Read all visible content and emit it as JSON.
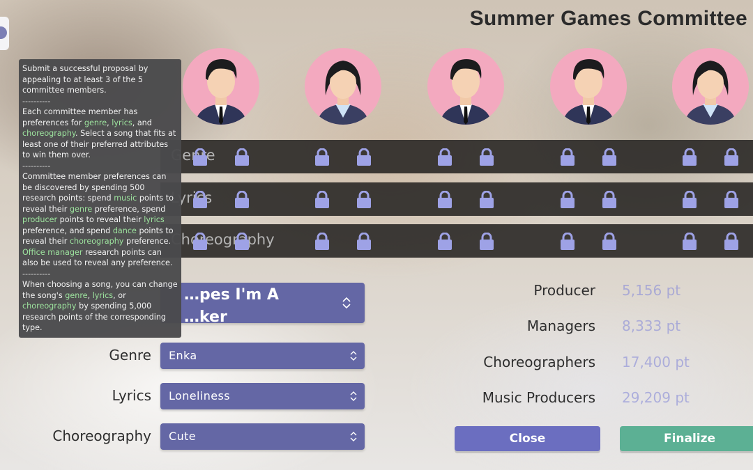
{
  "title": "Summer Games Committee",
  "members": [
    {
      "gender": "male"
    },
    {
      "gender": "female"
    },
    {
      "gender": "male"
    },
    {
      "gender": "male"
    },
    {
      "gender": "female"
    }
  ],
  "preference_rows": [
    {
      "label": "Genre",
      "locked": true
    },
    {
      "label": "Lyrics",
      "locked": true
    },
    {
      "label": "Choreography",
      "locked": true
    }
  ],
  "lock_icon": "padlock-icon",
  "song": {
    "line1": "…pes I'm A",
    "line2": "…ker"
  },
  "fields": {
    "genre_label": "Genre",
    "genre_value": "Enka",
    "lyrics_label": "Lyrics",
    "lyrics_value": "Loneliness",
    "choreography_label": "Choreography",
    "choreography_value": "Cute"
  },
  "research": [
    {
      "label": "Producer",
      "value": "5,156 pt"
    },
    {
      "label": "Managers",
      "value": "8,333 pt"
    },
    {
      "label": "Choreographers",
      "value": "17,400 pt"
    },
    {
      "label": "Music Producers",
      "value": "29,209 pt"
    }
  ],
  "buttons": {
    "close": "Close",
    "finalize": "Finalize"
  },
  "tooltip": {
    "p1": "Submit a successful proposal by appealing to at least 3 of the 5 committee members.",
    "sep": "----------",
    "p2_a": "Each committee member has preferences for ",
    "p2_genre": "genre",
    "p2_b": ", ",
    "p2_lyrics": "lyrics",
    "p2_c": ", and ",
    "p2_choreo": "choreography",
    "p2_d": ". Select a song that fits at least one of their preferred attributes to win them over.",
    "p3_a": "Committee member preferences can be discovered by spending 500 research points: spend ",
    "p3_music": "music",
    "p3_b": " points to reveal their ",
    "p3_genre": "genre",
    "p3_c": " preference, spend ",
    "p3_producer": "producer",
    "p3_d": " points to reveal their ",
    "p3_lyrics": "lyrics",
    "p3_e": " preference, and spend ",
    "p3_dance": "dance",
    "p3_f": " points to reveal their ",
    "p3_choreo": "choreography",
    "p3_g": " preference. ",
    "p3_office": "Office manager",
    "p3_h": " research points can also be used to reveal any preference.",
    "p4_a": "When choosing a song, you can change the song's ",
    "p4_genre": "genre",
    "p4_b": ", ",
    "p4_lyrics": "lyrics",
    "p4_c": ", or ",
    "p4_choreo": "choreography",
    "p4_d": " by spending 5,000 research points of the corresponding type."
  },
  "colors": {
    "accent": "#6467a5",
    "finalize": "#5cb094",
    "highlight": "#9ee59f",
    "avatar_bg": "#f3a9bf"
  }
}
